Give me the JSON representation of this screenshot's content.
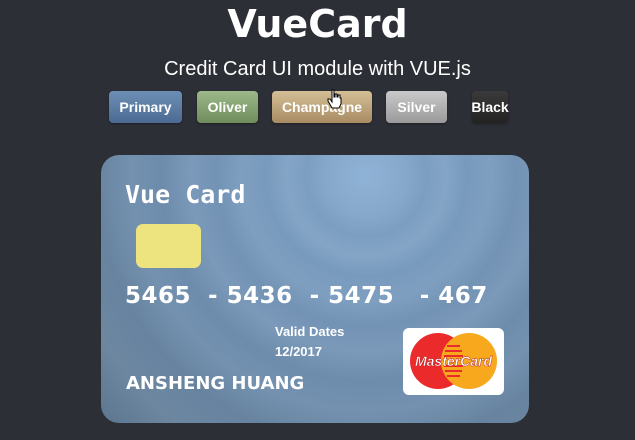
{
  "header": {
    "title": "VueCard",
    "subtitle": "Credit Card UI module with VUE.js"
  },
  "themes": {
    "items": [
      {
        "label": "Primary",
        "color": "#5a7ba4"
      },
      {
        "label": "Oliver",
        "color": "#84a372"
      },
      {
        "label": "Champagne",
        "color": "#bfa57b"
      },
      {
        "label": "Silver",
        "color": "#b3b3b3"
      },
      {
        "label": "Black",
        "color": "#2b2b2b"
      }
    ]
  },
  "card": {
    "brand": "Vue Card",
    "number": "5465  - 5436  - 5475   - 467",
    "valid_label": "Valid Dates",
    "valid_date": "12/2017",
    "holder": "ANSHENG HUANG",
    "network": "MasterCard",
    "chip_color": "#ede37f",
    "background_color": "#7a9bbf"
  }
}
